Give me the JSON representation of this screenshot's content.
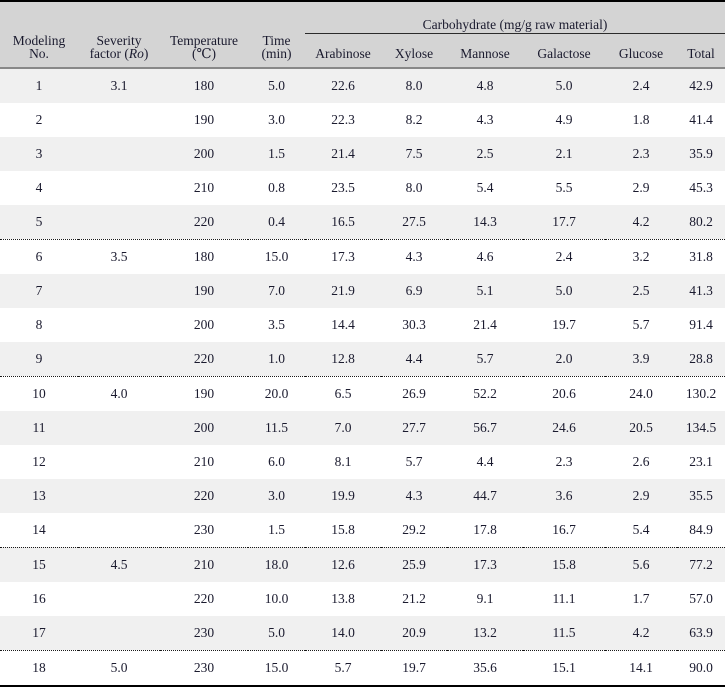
{
  "table": {
    "caption_present": false,
    "header": {
      "group_spanning": {
        "label": "Carbohydrate  (mg/g raw material)"
      },
      "columns": [
        {
          "key": "no",
          "line1": "Modeling",
          "line2": "No."
        },
        {
          "key": "severity",
          "line1": "Severity",
          "line2": "factor  (Ro)",
          "line2_prefix": "factor  (",
          "line2_italic": "Ro",
          "line2_suffix": ")"
        },
        {
          "key": "temp",
          "line1": "Temperature",
          "line2": "(℃)"
        },
        {
          "key": "time",
          "line1": "Time",
          "line2": "(min)"
        },
        {
          "key": "arabinose",
          "line1": "",
          "line2": "Arabinose"
        },
        {
          "key": "xylose",
          "line1": "",
          "line2": "Xylose"
        },
        {
          "key": "mannose",
          "line1": "",
          "line2": "Mannose"
        },
        {
          "key": "galactose",
          "line1": "",
          "line2": "Galactose"
        },
        {
          "key": "glucose",
          "line1": "",
          "line2": "Glucose"
        },
        {
          "key": "total",
          "line1": "",
          "line2": "Total"
        }
      ]
    },
    "rows": [
      {
        "no": "1",
        "severity": "3.1",
        "temp": "180",
        "time": "5.0",
        "arabinose": "22.6",
        "xylose": "8.0",
        "mannose": "4.8",
        "galactose": "5.0",
        "glucose": "2.4",
        "total": "42.9",
        "shaded": true,
        "group_end": false
      },
      {
        "no": "2",
        "severity": "",
        "temp": "190",
        "time": "3.0",
        "arabinose": "22.3",
        "xylose": "8.2",
        "mannose": "4.3",
        "galactose": "4.9",
        "glucose": "1.8",
        "total": "41.4",
        "shaded": false,
        "group_end": false
      },
      {
        "no": "3",
        "severity": "",
        "temp": "200",
        "time": "1.5",
        "arabinose": "21.4",
        "xylose": "7.5",
        "mannose": "2.5",
        "galactose": "2.1",
        "glucose": "2.3",
        "total": "35.9",
        "shaded": true,
        "group_end": false
      },
      {
        "no": "4",
        "severity": "",
        "temp": "210",
        "time": "0.8",
        "arabinose": "23.5",
        "xylose": "8.0",
        "mannose": "5.4",
        "galactose": "5.5",
        "glucose": "2.9",
        "total": "45.3",
        "shaded": false,
        "group_end": false
      },
      {
        "no": "5",
        "severity": "",
        "temp": "220",
        "time": "0.4",
        "arabinose": "16.5",
        "xylose": "27.5",
        "mannose": "14.3",
        "galactose": "17.7",
        "glucose": "4.2",
        "total": "80.2",
        "shaded": true,
        "group_end": true
      },
      {
        "no": "6",
        "severity": "3.5",
        "temp": "180",
        "time": "15.0",
        "arabinose": "17.3",
        "xylose": "4.3",
        "mannose": "4.6",
        "galactose": "2.4",
        "glucose": "3.2",
        "total": "31.8",
        "shaded": false,
        "group_end": false
      },
      {
        "no": "7",
        "severity": "",
        "temp": "190",
        "time": "7.0",
        "arabinose": "21.9",
        "xylose": "6.9",
        "mannose": "5.1",
        "galactose": "5.0",
        "glucose": "2.5",
        "total": "41.3",
        "shaded": true,
        "group_end": false
      },
      {
        "no": "8",
        "severity": "",
        "temp": "200",
        "time": "3.5",
        "arabinose": "14.4",
        "xylose": "30.3",
        "mannose": "21.4",
        "galactose": "19.7",
        "glucose": "5.7",
        "total": "91.4",
        "shaded": false,
        "group_end": false
      },
      {
        "no": "9",
        "severity": "",
        "temp": "220",
        "time": "1.0",
        "arabinose": "12.8",
        "xylose": "4.4",
        "mannose": "5.7",
        "galactose": "2.0",
        "glucose": "3.9",
        "total": "28.8",
        "shaded": true,
        "group_end": true
      },
      {
        "no": "10",
        "severity": "4.0",
        "temp": "190",
        "time": "20.0",
        "arabinose": "6.5",
        "xylose": "26.9",
        "mannose": "52.2",
        "galactose": "20.6",
        "glucose": "24.0",
        "total": "130.2",
        "shaded": false,
        "group_end": false
      },
      {
        "no": "11",
        "severity": "",
        "temp": "200",
        "time": "11.5",
        "arabinose": "7.0",
        "xylose": "27.7",
        "mannose": "56.7",
        "galactose": "24.6",
        "glucose": "20.5",
        "total": "134.5",
        "shaded": true,
        "group_end": false
      },
      {
        "no": "12",
        "severity": "",
        "temp": "210",
        "time": "6.0",
        "arabinose": "8.1",
        "xylose": "5.7",
        "mannose": "4.4",
        "galactose": "2.3",
        "glucose": "2.6",
        "total": "23.1",
        "shaded": false,
        "group_end": false
      },
      {
        "no": "13",
        "severity": "",
        "temp": "220",
        "time": "3.0",
        "arabinose": "19.9",
        "xylose": "4.3",
        "mannose": "44.7",
        "galactose": "3.6",
        "glucose": "2.9",
        "total": "35.5",
        "shaded": true,
        "group_end": false
      },
      {
        "no": "14",
        "severity": "",
        "temp": "230",
        "time": "1.5",
        "arabinose": "15.8",
        "xylose": "29.2",
        "mannose": "17.8",
        "galactose": "16.7",
        "glucose": "5.4",
        "total": "84.9",
        "shaded": false,
        "group_end": true
      },
      {
        "no": "15",
        "severity": "4.5",
        "temp": "210",
        "time": "18.0",
        "arabinose": "12.6",
        "xylose": "25.9",
        "mannose": "17.3",
        "galactose": "15.8",
        "glucose": "5.6",
        "total": "77.2",
        "shaded": true,
        "group_end": false
      },
      {
        "no": "16",
        "severity": "",
        "temp": "220",
        "time": "10.0",
        "arabinose": "13.8",
        "xylose": "21.2",
        "mannose": "9.1",
        "galactose": "11.1",
        "glucose": "1.7",
        "total": "57.0",
        "shaded": false,
        "group_end": false
      },
      {
        "no": "17",
        "severity": "",
        "temp": "230",
        "time": "5.0",
        "arabinose": "14.0",
        "xylose": "20.9",
        "mannose": "13.2",
        "galactose": "11.5",
        "glucose": "4.2",
        "total": "63.9",
        "shaded": true,
        "group_end": true
      },
      {
        "no": "18",
        "severity": "5.0",
        "temp": "230",
        "time": "15.0",
        "arabinose": "5.7",
        "xylose": "19.7",
        "mannose": "35.6",
        "galactose": "15.1",
        "glucose": "14.1",
        "total": "90.0",
        "shaded": false,
        "group_end": false
      }
    ]
  },
  "colors": {
    "header_background": "#d4d4d4",
    "row_shaded_background": "#f0f0f0",
    "row_plain_background": "#ffffff",
    "rule_color": "#000000",
    "text_color": "#1a1a2e"
  }
}
